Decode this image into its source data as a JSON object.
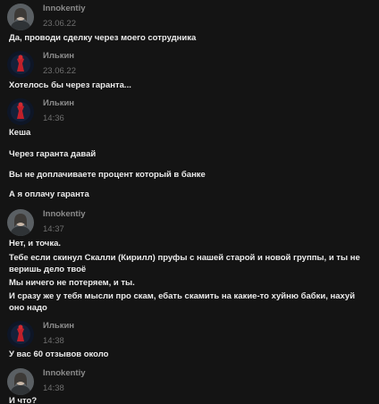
{
  "messages": [
    {
      "author": "Innokentiy",
      "time": "23.06.22",
      "avatar_icon": "girl-portrait-avatar",
      "lines": [
        "Да, проводи сделку через моего сотрудника"
      ]
    },
    {
      "author": "Илькин",
      "time": "23.06.22",
      "avatar_icon": "red-figure-dark-avatar",
      "lines": [
        "Хотелось бы через гаранта..."
      ]
    },
    {
      "author": "Илькин",
      "time": "14:36",
      "avatar_icon": "red-figure-dark-avatar",
      "lines": [
        "Кеша",
        "Через гаранта давай",
        "Вы не доплачиваете процент который в банке",
        "А я оплачу гаранта"
      ]
    },
    {
      "author": "Innokentiy",
      "time": "14:37",
      "avatar_icon": "girl-portrait-avatar",
      "lines": [
        "Нет, и точка.",
        "Тебе если скинул Скалли (Кирилл) пруфы с нашей старой и новой группы, и ты не",
        "веришь дело твоё",
        "Мы ничего не потеряем, и ты.",
        "И сразу же у тебя мысли про скам, ебать скамить на какие-то хуйню бабки, нахуй",
        "оно надо"
      ]
    },
    {
      "author": "Илькин",
      "time": "14:38",
      "avatar_icon": "red-figure-dark-avatar",
      "lines": [
        "У вас 60 отзывов около"
      ]
    },
    {
      "author": "Innokentiy",
      "time": "14:38",
      "avatar_icon": "girl-portrait-avatar",
      "lines": [
        "И что?"
      ]
    }
  ]
}
